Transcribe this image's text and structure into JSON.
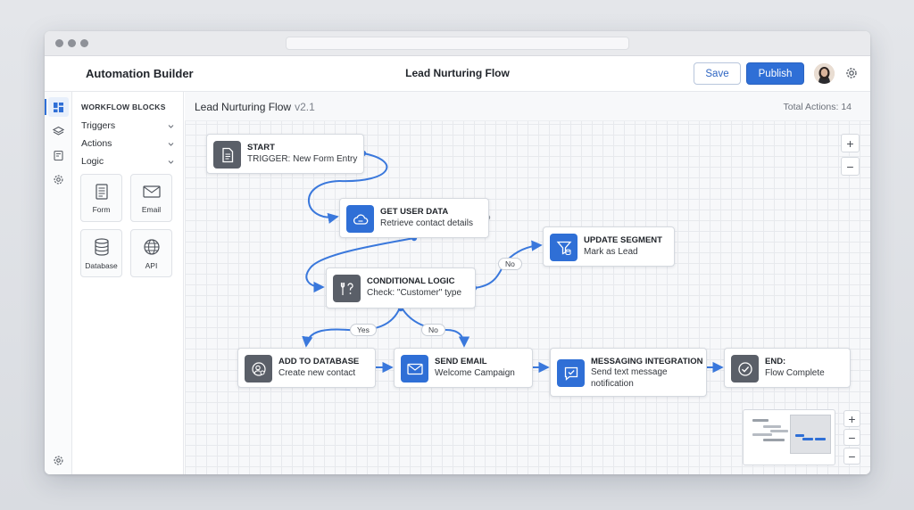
{
  "header": {
    "app_title": "Automation Builder",
    "flow_title": "Lead Nurturing Flow",
    "save_label": "Save",
    "publish_label": "Publish"
  },
  "rail": {
    "icons": [
      "dashboard-icon",
      "layers-icon",
      "notes-icon",
      "settings-icon"
    ],
    "bottom_icon": "settings-icon"
  },
  "sidebar": {
    "title": "WORKFLOW BLOCKS",
    "sections": [
      "Triggers",
      "Actions",
      "Logic"
    ],
    "tiles": [
      "Form",
      "Email",
      "Database",
      "API"
    ]
  },
  "canvas": {
    "title": "Lead Nurturing Flow",
    "version": "v2.1",
    "total_actions": "Total Actions: 14",
    "zoom_in": "+",
    "zoom_out": "−"
  },
  "nodes": {
    "start": {
      "title": "START",
      "subtitle": "TRIGGER: New Form Entry"
    },
    "get_user_data": {
      "title": "GET USER DATA",
      "subtitle": "Retrieve contact details"
    },
    "update_segment": {
      "title": "UPDATE SEGMENT",
      "subtitle": "Mark as Lead"
    },
    "conditional_logic": {
      "title": "CONDITIONAL LOGIC",
      "subtitle": "Check: \"Customer\" type"
    },
    "add_to_database": {
      "title": "ADD TO DATABASE",
      "subtitle": "Create new contact"
    },
    "send_email": {
      "title": "SEND EMAIL",
      "subtitle": "Welcome Campaign"
    },
    "messaging_integration": {
      "title": "MESSAGING INTEGRATION",
      "subtitle": "Send text message notification"
    },
    "end": {
      "title": "END:",
      "subtitle": "Flow Complete"
    }
  },
  "edge_labels": {
    "no_top": "No",
    "yes": "Yes",
    "no_bottom": "No"
  },
  "minimap": {
    "zoom_in": "+",
    "zoom_out": "−",
    "reset": "−"
  },
  "colors": {
    "accent": "#2f6fd6",
    "edge": "#3a78dc",
    "node_icon_gray": "#5a5f68"
  }
}
